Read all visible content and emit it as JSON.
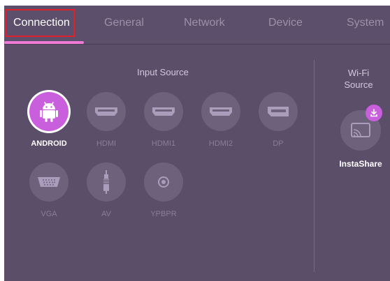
{
  "tabs": [
    {
      "label": "Connection",
      "active": true
    },
    {
      "label": "General",
      "active": false
    },
    {
      "label": "Network",
      "active": false
    },
    {
      "label": "Device",
      "active": false
    },
    {
      "label": "System",
      "active": false
    }
  ],
  "input_source": {
    "title": "Input Source",
    "items": [
      {
        "label": "ANDROID",
        "icon": "android-icon",
        "active": true
      },
      {
        "label": "HDMI",
        "icon": "hdmi-port-icon",
        "active": false
      },
      {
        "label": "HDMI1",
        "icon": "hdmi-port-icon",
        "active": false
      },
      {
        "label": "HDMI2",
        "icon": "hdmi-port-icon",
        "active": false
      },
      {
        "label": "DP",
        "icon": "displayport-icon",
        "active": false
      },
      {
        "label": "VGA",
        "icon": "vga-port-icon",
        "active": false
      },
      {
        "label": "AV",
        "icon": "av-cable-icon",
        "active": false
      },
      {
        "label": "YPBPR",
        "icon": "ypbpr-jack-icon",
        "active": false
      }
    ]
  },
  "wifi_source": {
    "title_line1": "Wi-Fi",
    "title_line2": "Source",
    "items": [
      {
        "label": "InstaShare",
        "icon": "cast-screen-icon",
        "badge_icon": "download-icon"
      }
    ]
  },
  "colors": {
    "panel_bg": "#5b4e69",
    "accent": "#c95fdc",
    "underline": "#ef7ad6",
    "highlight_box": "#e0202b"
  }
}
